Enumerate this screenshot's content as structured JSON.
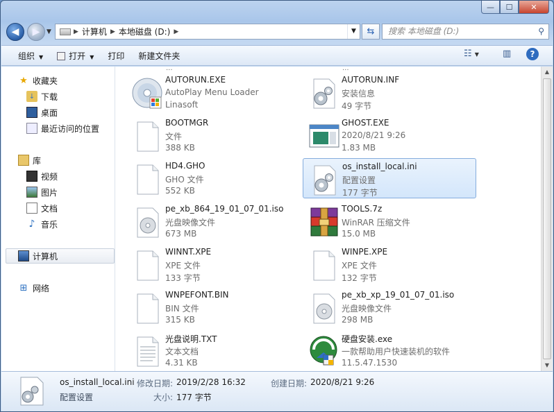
{
  "window": {
    "minimize": "—",
    "maximize": "☐",
    "close": "✕"
  },
  "address": {
    "segments": [
      "计算机",
      "本地磁盘 (D:)"
    ]
  },
  "search": {
    "placeholder": "搜索 本地磁盘 (D:)"
  },
  "toolbar": {
    "organize": "组织",
    "open": "打开",
    "print": "打印",
    "new_folder": "新建文件夹"
  },
  "nav": {
    "favorites": "收藏夹",
    "downloads": "下载",
    "desktop": "桌面",
    "recent": "最近访问的位置",
    "libraries": "库",
    "videos": "视频",
    "pictures": "图片",
    "documents": "文档",
    "music": "音乐",
    "computer": "计算机",
    "network": "网络"
  },
  "files": [
    {
      "name": "AUTORUN.EXE",
      "line2": "AutoPlay Menu Loader",
      "line3": "Linasoft",
      "icon": "autoplay-disc-icon"
    },
    {
      "name": "AUTORUN.INF",
      "line2": "安装信息",
      "line3": "49 字节",
      "icon": "settings-file-icon"
    },
    {
      "name": "BOOTMGR",
      "line2": "文件",
      "line3": "388 KB",
      "icon": "blank-file-icon"
    },
    {
      "name": "GHOST.EXE",
      "line2": "2020/8/21 9:26",
      "line3": "1.83 MB",
      "icon": "application-window-icon"
    },
    {
      "name": "HD4.GHO",
      "line2": "GHO 文件",
      "line3": "552 KB",
      "icon": "blank-file-icon"
    },
    {
      "name": "os_install_local.ini",
      "line2": "配置设置",
      "line3": "177 字节",
      "icon": "settings-file-icon",
      "selected": true
    },
    {
      "name": "pe_xb_864_19_01_07_01.iso",
      "line2": "光盘映像文件",
      "line3": "673 MB",
      "icon": "disc-image-icon"
    },
    {
      "name": "TOOLS.7z",
      "line2": "WinRAR 压缩文件",
      "line3": "15.0 MB",
      "icon": "winrar-archive-icon"
    },
    {
      "name": "WINNT.XPE",
      "line2": "XPE 文件",
      "line3": "133 字节",
      "icon": "blank-file-icon"
    },
    {
      "name": "WINPE.XPE",
      "line2": "XPE 文件",
      "line3": "132 字节",
      "icon": "blank-file-icon"
    },
    {
      "name": "WNPEFONT.BIN",
      "line2": "BIN 文件",
      "line3": "315 KB",
      "icon": "blank-file-icon"
    },
    {
      "name": "pe_xb_xp_19_01_07_01.iso",
      "line2": "光盘映像文件",
      "line3": "298 MB",
      "icon": "disc-image-icon"
    },
    {
      "name": "光盘说明.TXT",
      "line2": "文本文档",
      "line3": "4.31 KB",
      "icon": "text-file-icon"
    },
    {
      "name": "硬盘安装.exe",
      "line2": "一款帮助用户快速装机的软件",
      "line3": "11.5.47.1530",
      "icon": "installer-shield-icon"
    }
  ],
  "details": {
    "name": "os_install_local.ini",
    "type": "配置设置",
    "modified_label": "修改日期:",
    "modified_value": "2019/2/28 16:32",
    "created_label": "创建日期:",
    "created_value": "2020/8/21 9:26",
    "size_label": "大小:",
    "size_value": "177 字节"
  }
}
